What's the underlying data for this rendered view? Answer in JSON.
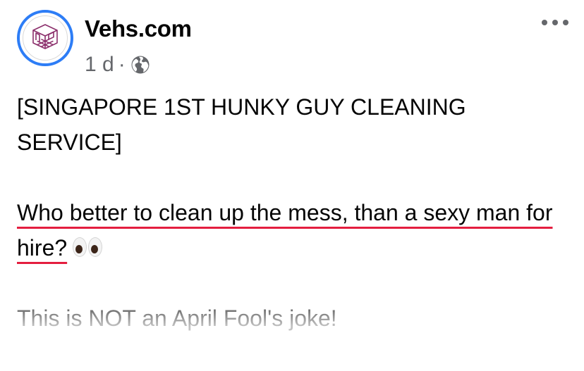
{
  "post": {
    "author": "Vehs.com",
    "timestamp": "1 d",
    "separator": "·",
    "audience_icon": "globe-icon",
    "more_icon": "more-options-icon",
    "avatar_icon": "isometric-room-logo"
  },
  "body": {
    "headline": "[SINGAPORE 1ST HUNKY GUY CLEANING SERVICE]",
    "line_misspelled": "Who better to clean up the mess, than a sexy man for hire?",
    "emoji": "eyes-emoji",
    "disclaimer": "This is NOT an April Fool's joke!"
  },
  "colors": {
    "avatar_ring": "#2d7df6",
    "logo": "#8b2e6b",
    "spellcheck_underline": "#e41e3f",
    "meta_text": "#65676b"
  }
}
